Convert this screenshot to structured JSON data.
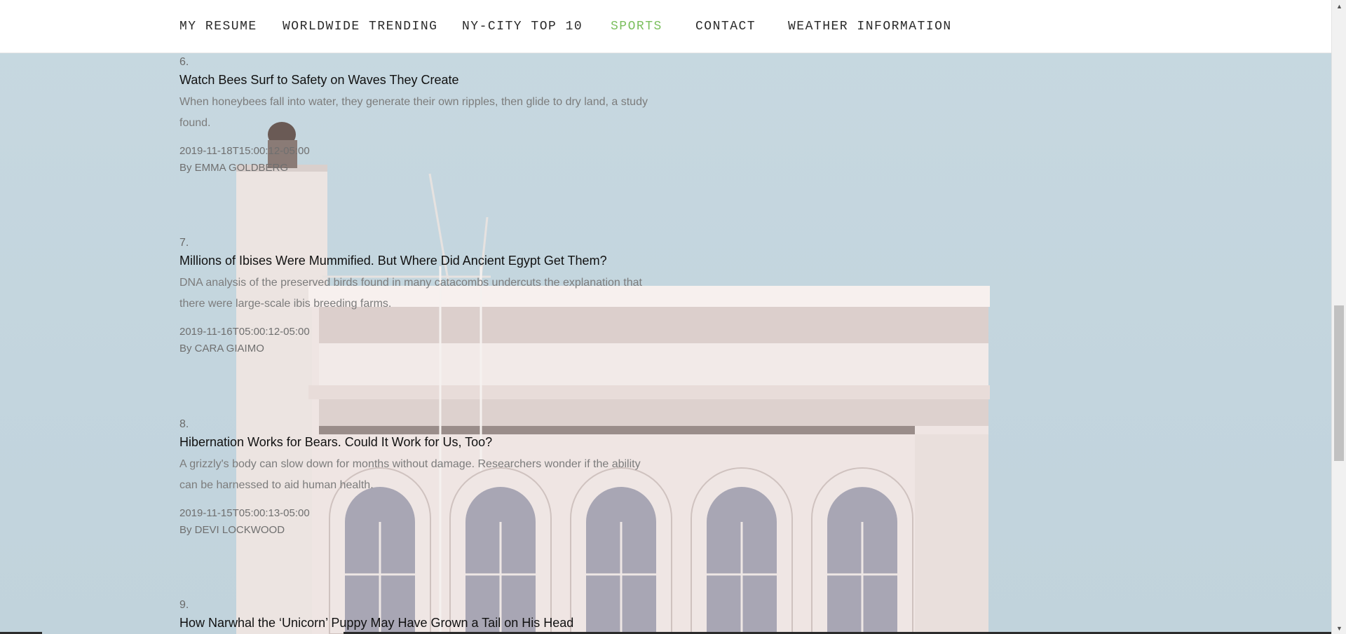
{
  "nav": {
    "items": [
      {
        "label": "MY RESUME"
      },
      {
        "label": "WORLDWIDE TRENDING"
      },
      {
        "label": "NY-CITY TOP 10"
      },
      {
        "label": "SPORTS"
      },
      {
        "label": "CONTACT"
      },
      {
        "label": "WEATHER INFORMATION"
      }
    ],
    "active_color": "#7bbf5e"
  },
  "articles": [
    {
      "number": "6.",
      "title": "Watch Bees Surf to Safety on Waves They Create",
      "abstract": "When honeybees fall into water, they generate their own ripples, then glide to dry land, a study found.",
      "date": "2019-11-18T15:00:12-05:00",
      "byline": "By EMMA GOLDBERG"
    },
    {
      "number": "7.",
      "title": "Millions of Ibises Were Mummified. But Where Did Ancient Egypt Get Them?",
      "abstract": "DNA analysis of the preserved birds found in many catacombs undercuts the explanation that there were large-scale ibis breeding farms.",
      "date": "2019-11-16T05:00:12-05:00",
      "byline": "By CARA GIAIMO"
    },
    {
      "number": "8.",
      "title": "Hibernation Works for Bears. Could It Work for Us, Too?",
      "abstract": "A grizzly's body can slow down for months without damage. Researchers wonder if the ability can be harnessed to aid human health.",
      "date": "2019-11-15T05:00:13-05:00",
      "byline": "By DEVI LOCKWOOD"
    },
    {
      "number": "9.",
      "title": "How Narwhal the ‘Unicorn’ Puppy May Have Grown a Tail on His Head"
    }
  ],
  "icons": {
    "scroll_up": "scroll-up-arrow-icon",
    "scroll_down": "scroll-down-arrow-icon"
  }
}
